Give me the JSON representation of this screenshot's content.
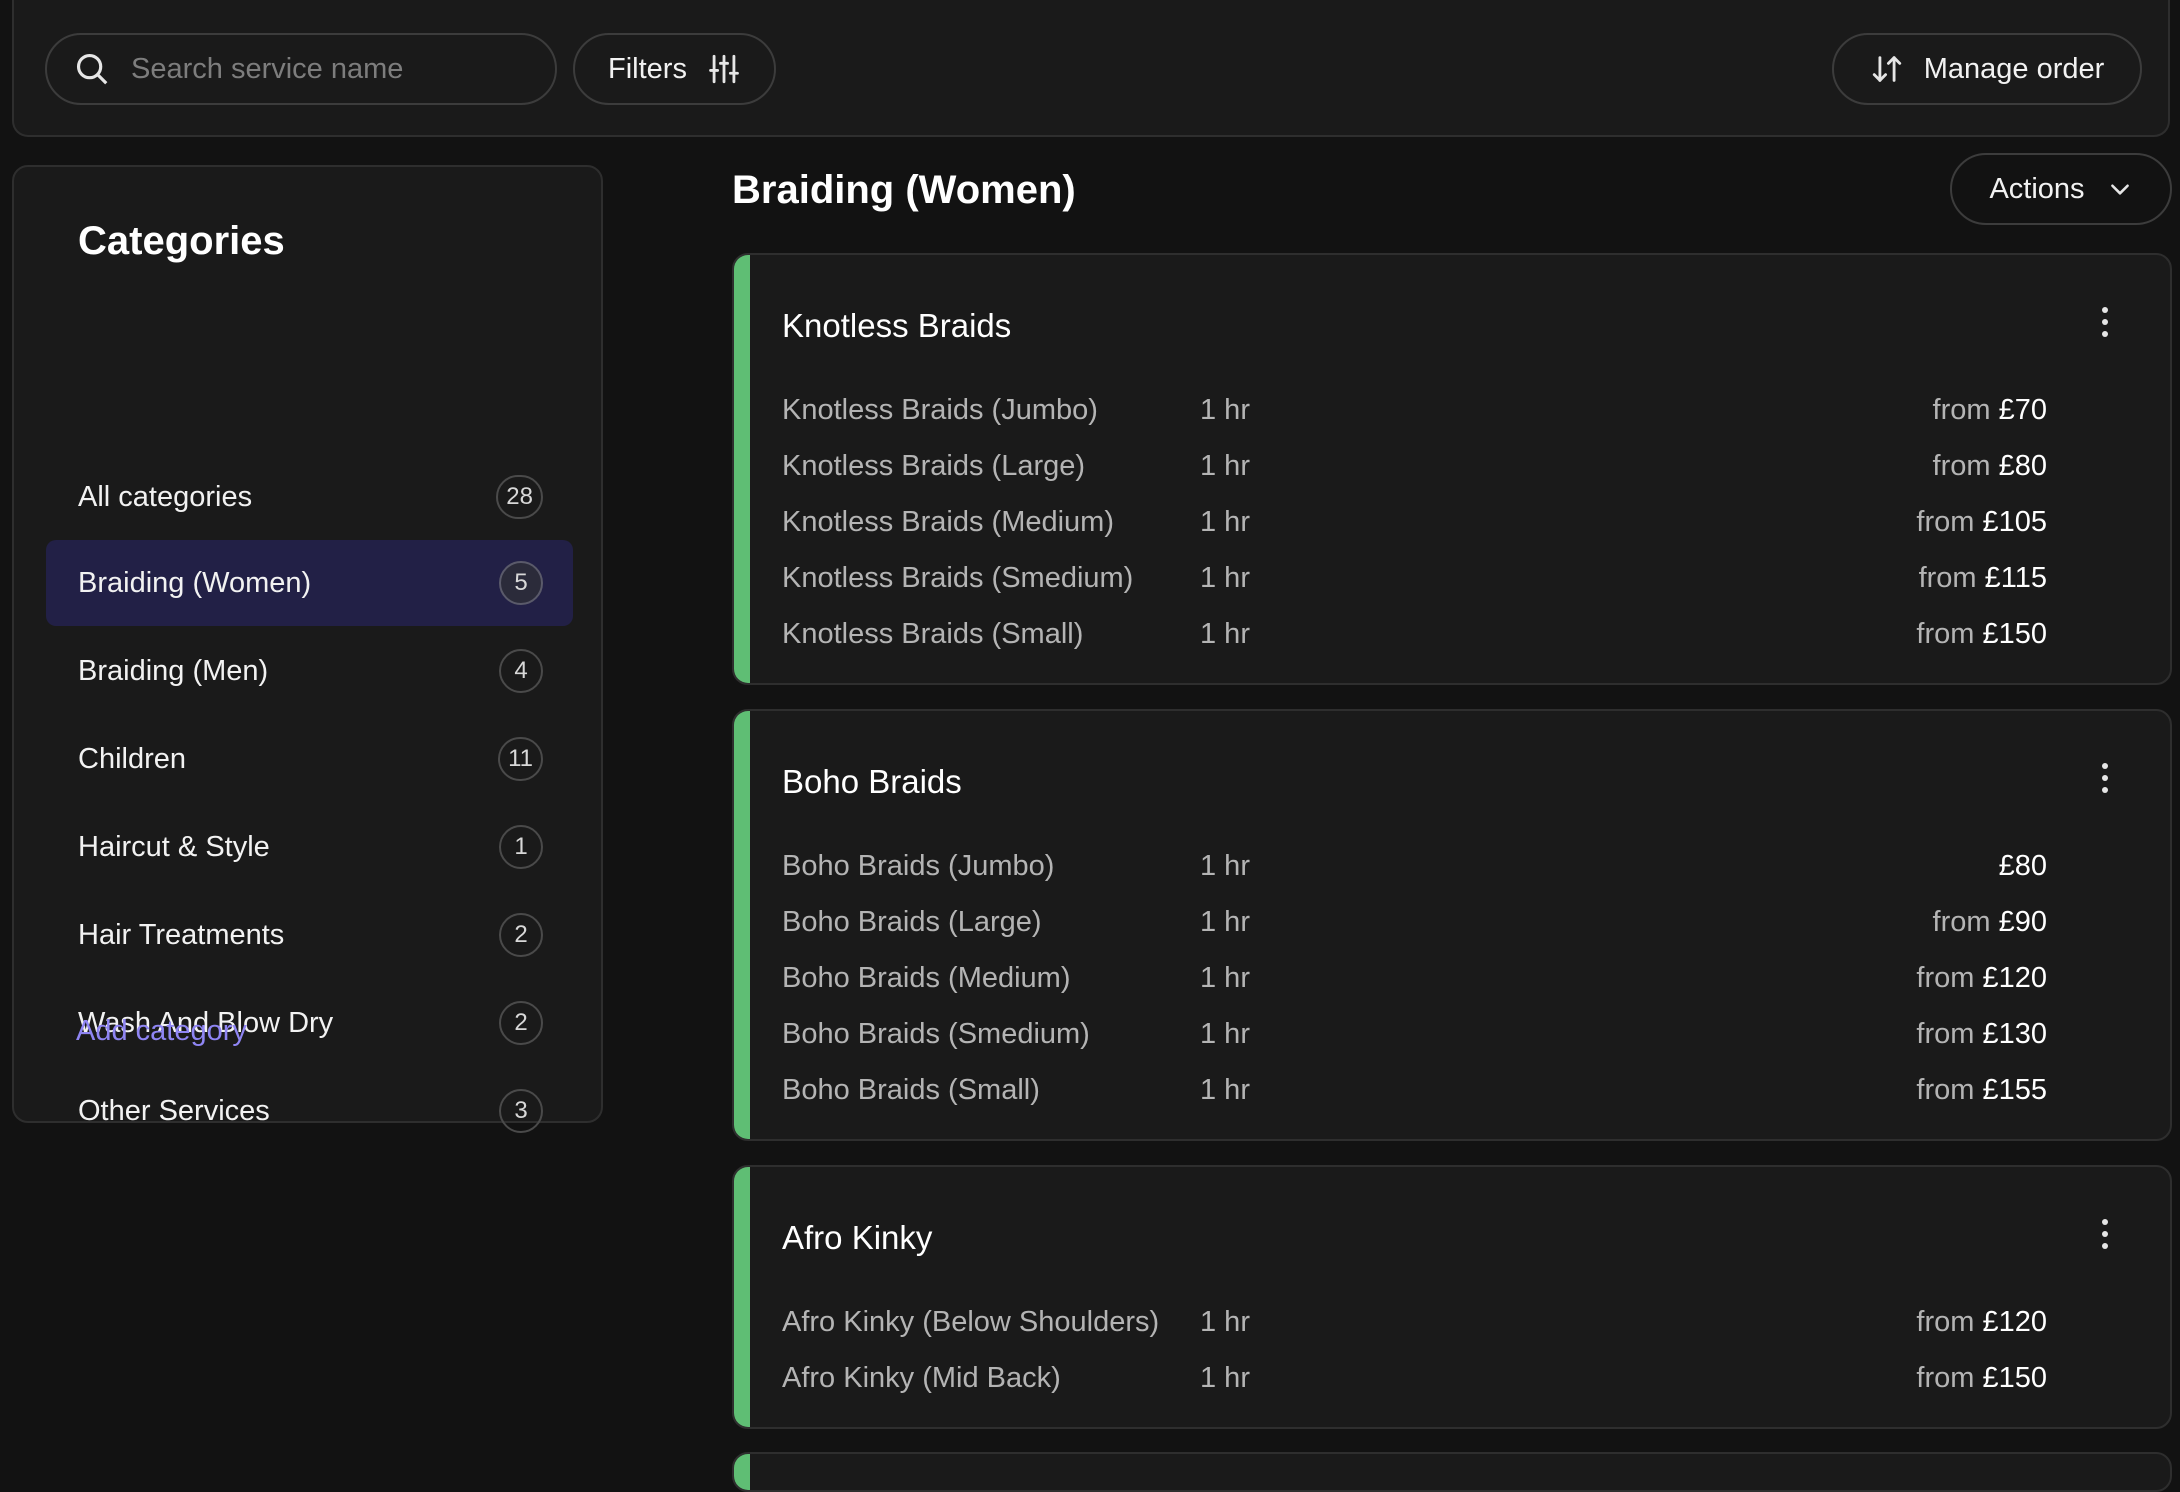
{
  "toolbar": {
    "search_placeholder": "Search service name",
    "filters_label": "Filters",
    "manage_order_label": "Manage order"
  },
  "sidebar": {
    "title": "Categories",
    "items": [
      {
        "label": "All categories",
        "count": "28"
      },
      {
        "label": "Braiding (Women)",
        "count": "5",
        "active": true
      },
      {
        "label": "Braiding (Men)",
        "count": "4"
      },
      {
        "label": "Children",
        "count": "11"
      },
      {
        "label": "Haircut & Style",
        "count": "1"
      },
      {
        "label": "Hair Treatments",
        "count": "2"
      },
      {
        "label": "Wash And Blow Dry",
        "count": "2"
      },
      {
        "label": "Other Services",
        "count": "3"
      }
    ],
    "add_category_label": "Add category"
  },
  "main": {
    "section_title": "Braiding (Women)",
    "actions_label": "Actions",
    "accent_color": "#5fbe74",
    "services": [
      {
        "title": "Knotless Braids",
        "variants": [
          {
            "name": "Knotless Braids (Jumbo)",
            "duration": "1 hr",
            "price_prefix": "from",
            "price": "£70"
          },
          {
            "name": "Knotless Braids (Large)",
            "duration": "1 hr",
            "price_prefix": "from",
            "price": "£80"
          },
          {
            "name": "Knotless Braids (Medium)",
            "duration": "1 hr",
            "price_prefix": "from",
            "price": "£105"
          },
          {
            "name": "Knotless Braids (Smedium)",
            "duration": "1 hr",
            "price_prefix": "from",
            "price": "£115"
          },
          {
            "name": "Knotless Braids (Small)",
            "duration": "1 hr",
            "price_prefix": "from",
            "price": "£150"
          }
        ]
      },
      {
        "title": "Boho Braids",
        "variants": [
          {
            "name": "Boho Braids (Jumbo)",
            "duration": "1 hr",
            "price_prefix": "",
            "price": "£80"
          },
          {
            "name": "Boho Braids (Large)",
            "duration": "1 hr",
            "price_prefix": "from",
            "price": "£90"
          },
          {
            "name": "Boho Braids (Medium)",
            "duration": "1 hr",
            "price_prefix": "from",
            "price": "£120"
          },
          {
            "name": "Boho Braids (Smedium)",
            "duration": "1 hr",
            "price_prefix": "from",
            "price": "£130"
          },
          {
            "name": "Boho Braids (Small)",
            "duration": "1 hr",
            "price_prefix": "from",
            "price": "£155"
          }
        ]
      },
      {
        "title": "Afro Kinky",
        "variants": [
          {
            "name": "Afro Kinky (Below Shoulders)",
            "duration": "1 hr",
            "price_prefix": "from",
            "price": "£120"
          },
          {
            "name": "Afro Kinky (Mid Back)",
            "duration": "1 hr",
            "price_prefix": "from",
            "price": "£150"
          }
        ]
      }
    ]
  }
}
